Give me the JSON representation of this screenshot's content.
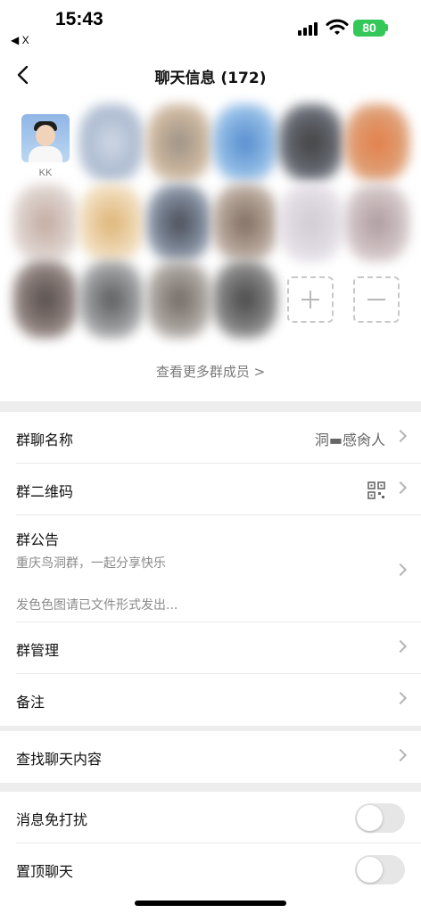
{
  "status_bar": {
    "time": "15:43",
    "back_app": "◀ X",
    "battery": "80"
  },
  "nav": {
    "title": "聊天信息 (172)",
    "back_icon": "chevron-left-icon"
  },
  "members": {
    "first_member_name": "KK",
    "see_more": "查看更多群成员 >"
  },
  "group_info": {
    "name_label": "群聊名称",
    "name_value": "洞▬感肏人",
    "qrcode_label": "群二维码",
    "notice_title": "群公告",
    "notice_line1": "重庆鸟洞群，一起分享快乐",
    "notice_line2": "发色色图请已文件形式发出...",
    "manage_label": "群管理",
    "remark_label": "备注"
  },
  "search": {
    "label": "查找聊天内容"
  },
  "toggles": {
    "mute_label": "消息免打扰",
    "pin_label": "置顶聊天"
  },
  "colors": {
    "accent_green": "#34c759",
    "background": "#ededed"
  }
}
